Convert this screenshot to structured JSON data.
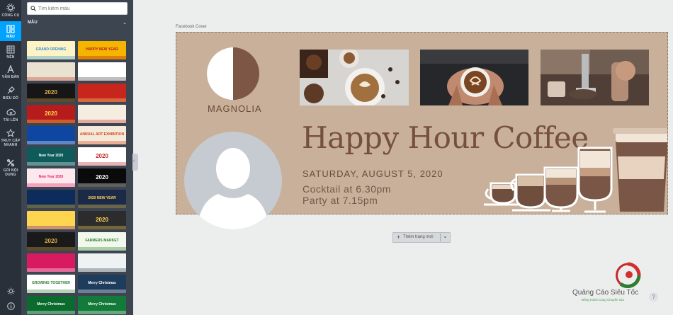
{
  "rail": {
    "items": [
      {
        "label": "CÔNG CỤ",
        "icon": "tools-icon"
      },
      {
        "label": "MẪU",
        "icon": "template-icon",
        "active": true
      },
      {
        "label": "NỀN",
        "icon": "background-icon"
      },
      {
        "label": "VĂN BẢN",
        "icon": "text-icon"
      },
      {
        "label": "BIỂU ĐỒ",
        "icon": "chart-icon"
      },
      {
        "label": "TẢI LÊN",
        "icon": "upload-icon"
      },
      {
        "label": "TRUY CẬP NHANH",
        "icon": "star-icon"
      },
      {
        "label": "GÓI NỘI DUNG",
        "icon": "bundle-icon"
      }
    ],
    "bottom_icons": [
      "theme-icon",
      "info-icon"
    ]
  },
  "panel": {
    "search_placeholder": "Tìm kiếm mẫu",
    "section_label": "MẪU",
    "thumbnails": [
      {
        "bg": "#fdf3c4",
        "fg": "#2a8fd6",
        "text": "GRAND OPENING"
      },
      {
        "bg": "#f4b400",
        "fg": "#b71c1c",
        "text": "HAPPY NEW YEAR"
      },
      {
        "bg": "#e9e2d0",
        "fg": "#c0392b",
        "text": ""
      },
      {
        "bg": "#ffffff",
        "fg": "#444444",
        "text": ""
      },
      {
        "bg": "#161616",
        "fg": "#e0b04a",
        "text": "2020"
      },
      {
        "bg": "#c7261d",
        "fg": "#ffe082",
        "text": ""
      },
      {
        "bg": "#b71c1c",
        "fg": "#ffd54f",
        "text": "2020"
      },
      {
        "bg": "#f5eee0",
        "fg": "#c62828",
        "text": ""
      },
      {
        "bg": "#0d47a1",
        "fg": "#ffffff",
        "text": ""
      },
      {
        "bg": "#f4eadb",
        "fg": "#d84315",
        "text": "ANNUAL ART EXHIBITION"
      },
      {
        "bg": "#0f5a5a",
        "fg": "#ffffff",
        "text": "New Year 2020"
      },
      {
        "bg": "#ffffff",
        "fg": "#c62828",
        "text": "2020"
      },
      {
        "bg": "#fde8ee",
        "fg": "#e91e63",
        "text": "New Year 2020"
      },
      {
        "bg": "#0a0a0a",
        "fg": "#ffffff",
        "text": "2020"
      },
      {
        "bg": "#0d2c5b",
        "fg": "#ffca28",
        "text": ""
      },
      {
        "bg": "#1b2a49",
        "fg": "#ffd54f",
        "text": "2020 NEW YEAR"
      },
      {
        "bg": "#ffd54f",
        "fg": "#6a1b9a",
        "text": ""
      },
      {
        "bg": "#2c2c2c",
        "fg": "#ffd54f",
        "text": "2020"
      },
      {
        "bg": "#1a1a1a",
        "fg": "#e0b04a",
        "text": "2020"
      },
      {
        "bg": "#f2f8ec",
        "fg": "#2e7d32",
        "text": "FARMERS MARKET"
      },
      {
        "bg": "#d81b60",
        "fg": "#ffffff",
        "text": ""
      },
      {
        "bg": "#eef2f3",
        "fg": "#37474f",
        "text": ""
      },
      {
        "bg": "#ffffff",
        "fg": "#2e7d32",
        "text": "GROWING TOGETHER"
      },
      {
        "bg": "#1e3d5c",
        "fg": "#ffffff",
        "text": "Merry Christmas"
      },
      {
        "bg": "#0b6b2e",
        "fg": "#ffffff",
        "text": "Merry Christmas"
      },
      {
        "bg": "#147a3a",
        "fg": "#ffffff",
        "text": "Merry Christmas"
      }
    ]
  },
  "canvas": {
    "cover_label": "Facebook Cover",
    "brand": "MAGNOLIA",
    "headline": "Happy Hour Coffee",
    "date": "SATURDAY, AUGUST 5, 2020",
    "event_1": "Cocktail at 6.30pm",
    "event_2": "Party at 7.15pm",
    "colors": {
      "cover_bg": "#c8b09a",
      "brown": "#76503e",
      "cream": "#ffffff"
    }
  },
  "add_page": {
    "label": "Thêm trang mới"
  },
  "watermark": {
    "name": "Quảng Cáo Siêu Tốc",
    "slogan": "Đồng Hành Cùng Chuyên Gia"
  },
  "help": "?"
}
